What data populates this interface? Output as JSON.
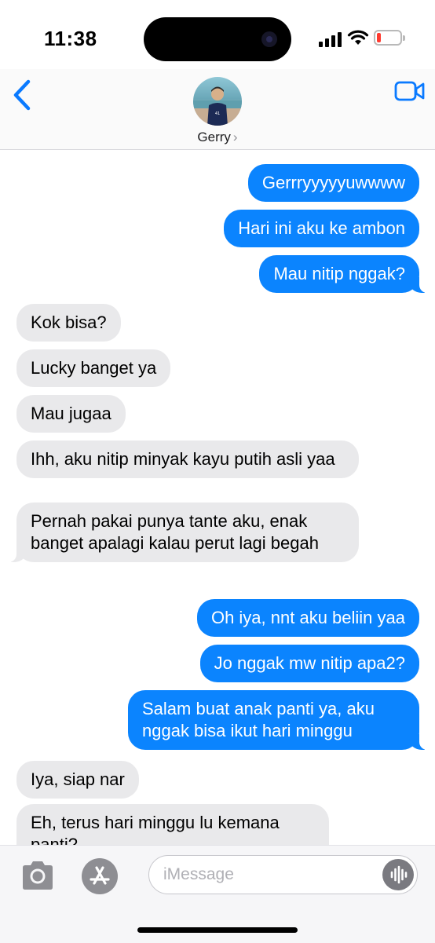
{
  "status": {
    "time": "11:38"
  },
  "contact": {
    "name": "Gerry",
    "avatar": "avatar-photo"
  },
  "icons": {
    "back": "chevron-left-icon",
    "video": "video-camera-icon",
    "camera": "camera-icon",
    "appstore": "app-store-icon",
    "audio": "waveform-icon"
  },
  "colors": {
    "outgoing": "#0b84fe",
    "incoming": "#e9e9eb",
    "accent": "#0a7aff",
    "battery_low": "#ff3b30"
  },
  "messages": [
    {
      "dir": "out",
      "text": "Gerrryyyyyuwwww"
    },
    {
      "dir": "out",
      "text": "Hari ini aku ke ambon"
    },
    {
      "dir": "out",
      "text": "Mau nitip nggak?"
    },
    {
      "dir": "in",
      "text": "Kok bisa?"
    },
    {
      "dir": "in",
      "text": "Lucky banget ya"
    },
    {
      "dir": "in",
      "text": "Mau jugaa"
    },
    {
      "dir": "in",
      "text": "Ihh, aku nitip minyak kayu putih asli yaa"
    },
    {
      "dir": "in",
      "text": "Pernah pakai punya tante aku, enak banget apalagi kalau perut lagi begah"
    },
    {
      "dir": "out",
      "text": "Oh iya, nnt aku beliin yaa"
    },
    {
      "dir": "out",
      "text": "Jo nggak mw nitip apa2?"
    },
    {
      "dir": "out",
      "text": "Salam buat anak panti ya, aku nggak bisa ikut hari minggu"
    },
    {
      "dir": "in",
      "text": "Iya, siap nar"
    },
    {
      "dir": "in",
      "text": "Eh, terus hari minggu lu kemana panti?"
    }
  ],
  "composer": {
    "placeholder": "iMessage"
  }
}
